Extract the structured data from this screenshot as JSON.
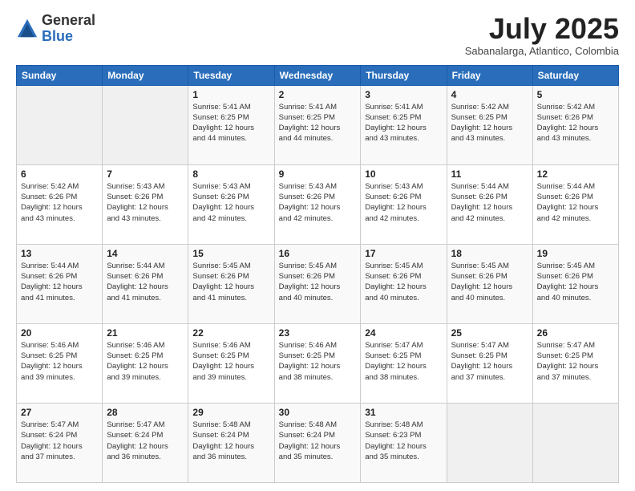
{
  "header": {
    "logo_general": "General",
    "logo_blue": "Blue",
    "month_year": "July 2025",
    "location": "Sabanalarga, Atlantico, Colombia"
  },
  "weekdays": [
    "Sunday",
    "Monday",
    "Tuesday",
    "Wednesday",
    "Thursday",
    "Friday",
    "Saturday"
  ],
  "weeks": [
    [
      {
        "day": "",
        "info": ""
      },
      {
        "day": "",
        "info": ""
      },
      {
        "day": "1",
        "info": "Sunrise: 5:41 AM\nSunset: 6:25 PM\nDaylight: 12 hours\nand 44 minutes."
      },
      {
        "day": "2",
        "info": "Sunrise: 5:41 AM\nSunset: 6:25 PM\nDaylight: 12 hours\nand 44 minutes."
      },
      {
        "day": "3",
        "info": "Sunrise: 5:41 AM\nSunset: 6:25 PM\nDaylight: 12 hours\nand 43 minutes."
      },
      {
        "day": "4",
        "info": "Sunrise: 5:42 AM\nSunset: 6:25 PM\nDaylight: 12 hours\nand 43 minutes."
      },
      {
        "day": "5",
        "info": "Sunrise: 5:42 AM\nSunset: 6:26 PM\nDaylight: 12 hours\nand 43 minutes."
      }
    ],
    [
      {
        "day": "6",
        "info": "Sunrise: 5:42 AM\nSunset: 6:26 PM\nDaylight: 12 hours\nand 43 minutes."
      },
      {
        "day": "7",
        "info": "Sunrise: 5:43 AM\nSunset: 6:26 PM\nDaylight: 12 hours\nand 43 minutes."
      },
      {
        "day": "8",
        "info": "Sunrise: 5:43 AM\nSunset: 6:26 PM\nDaylight: 12 hours\nand 42 minutes."
      },
      {
        "day": "9",
        "info": "Sunrise: 5:43 AM\nSunset: 6:26 PM\nDaylight: 12 hours\nand 42 minutes."
      },
      {
        "day": "10",
        "info": "Sunrise: 5:43 AM\nSunset: 6:26 PM\nDaylight: 12 hours\nand 42 minutes."
      },
      {
        "day": "11",
        "info": "Sunrise: 5:44 AM\nSunset: 6:26 PM\nDaylight: 12 hours\nand 42 minutes."
      },
      {
        "day": "12",
        "info": "Sunrise: 5:44 AM\nSunset: 6:26 PM\nDaylight: 12 hours\nand 42 minutes."
      }
    ],
    [
      {
        "day": "13",
        "info": "Sunrise: 5:44 AM\nSunset: 6:26 PM\nDaylight: 12 hours\nand 41 minutes."
      },
      {
        "day": "14",
        "info": "Sunrise: 5:44 AM\nSunset: 6:26 PM\nDaylight: 12 hours\nand 41 minutes."
      },
      {
        "day": "15",
        "info": "Sunrise: 5:45 AM\nSunset: 6:26 PM\nDaylight: 12 hours\nand 41 minutes."
      },
      {
        "day": "16",
        "info": "Sunrise: 5:45 AM\nSunset: 6:26 PM\nDaylight: 12 hours\nand 40 minutes."
      },
      {
        "day": "17",
        "info": "Sunrise: 5:45 AM\nSunset: 6:26 PM\nDaylight: 12 hours\nand 40 minutes."
      },
      {
        "day": "18",
        "info": "Sunrise: 5:45 AM\nSunset: 6:26 PM\nDaylight: 12 hours\nand 40 minutes."
      },
      {
        "day": "19",
        "info": "Sunrise: 5:45 AM\nSunset: 6:26 PM\nDaylight: 12 hours\nand 40 minutes."
      }
    ],
    [
      {
        "day": "20",
        "info": "Sunrise: 5:46 AM\nSunset: 6:25 PM\nDaylight: 12 hours\nand 39 minutes."
      },
      {
        "day": "21",
        "info": "Sunrise: 5:46 AM\nSunset: 6:25 PM\nDaylight: 12 hours\nand 39 minutes."
      },
      {
        "day": "22",
        "info": "Sunrise: 5:46 AM\nSunset: 6:25 PM\nDaylight: 12 hours\nand 39 minutes."
      },
      {
        "day": "23",
        "info": "Sunrise: 5:46 AM\nSunset: 6:25 PM\nDaylight: 12 hours\nand 38 minutes."
      },
      {
        "day": "24",
        "info": "Sunrise: 5:47 AM\nSunset: 6:25 PM\nDaylight: 12 hours\nand 38 minutes."
      },
      {
        "day": "25",
        "info": "Sunrise: 5:47 AM\nSunset: 6:25 PM\nDaylight: 12 hours\nand 37 minutes."
      },
      {
        "day": "26",
        "info": "Sunrise: 5:47 AM\nSunset: 6:25 PM\nDaylight: 12 hours\nand 37 minutes."
      }
    ],
    [
      {
        "day": "27",
        "info": "Sunrise: 5:47 AM\nSunset: 6:24 PM\nDaylight: 12 hours\nand 37 minutes."
      },
      {
        "day": "28",
        "info": "Sunrise: 5:47 AM\nSunset: 6:24 PM\nDaylight: 12 hours\nand 36 minutes."
      },
      {
        "day": "29",
        "info": "Sunrise: 5:48 AM\nSunset: 6:24 PM\nDaylight: 12 hours\nand 36 minutes."
      },
      {
        "day": "30",
        "info": "Sunrise: 5:48 AM\nSunset: 6:24 PM\nDaylight: 12 hours\nand 35 minutes."
      },
      {
        "day": "31",
        "info": "Sunrise: 5:48 AM\nSunset: 6:23 PM\nDaylight: 12 hours\nand 35 minutes."
      },
      {
        "day": "",
        "info": ""
      },
      {
        "day": "",
        "info": ""
      }
    ]
  ]
}
